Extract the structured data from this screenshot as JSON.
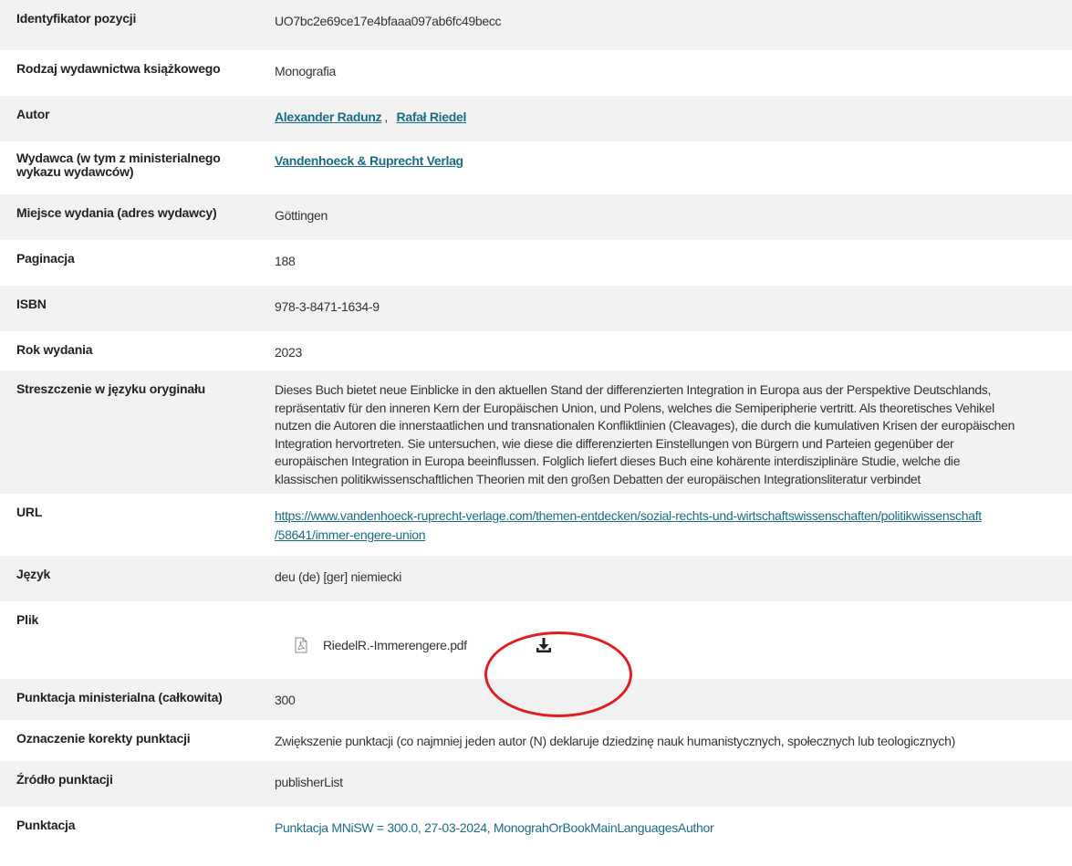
{
  "rows": [
    {
      "label": "Identyfikator pozycji",
      "value": "UO7bc2e69ce17e4bfaaa097ab6fc49becc"
    },
    {
      "label": "Rodzaj wydawnictwa książkowego",
      "value": "Monografia"
    },
    {
      "label": "Autor",
      "authors": [
        "Alexander Radunz",
        "Rafał Riedel"
      ],
      "separator": ","
    },
    {
      "label": "Wydawca (w tym z ministerialnego wykazu wydawców)",
      "publisher": "Vandenhoeck & Ruprecht Verlag"
    },
    {
      "label": "Miejsce wydania (adres wydawcy)",
      "value": "Göttingen"
    },
    {
      "label": "Paginacja",
      "value": "188"
    },
    {
      "label": "ISBN",
      "value": "978-3-8471-1634-9"
    },
    {
      "label": "Rok wydania",
      "value": "2023"
    },
    {
      "label": "Streszczenie w języku oryginału",
      "lines": [
        "Dieses Buch bietet neue Einblicke in den aktuellen Stand der differenzierten Integration in Europa aus der Perspektive Deutschlands,",
        "repräsentativ für den inneren Kern der Europäischen Union, und Polens, welches die Semiperipherie vertritt. Als theoretisches Vehikel",
        "nutzen die Autoren die innerstaatlichen und transnationalen Konfliktlinien (Cleavages), die durch die kumulativen Krisen der europäischen",
        "Integration hervortreten. Sie untersuchen, wie diese die differenzierten Einstellungen von Bürgern und Parteien gegenüber der",
        "europäischen Integration in Europa beeinflussen. Folglich liefert dieses Buch eine kohärente interdisziplinäre Studie, welche die",
        "klassischen politikwissenschaftlichen Theorien mit den großen Debatten der europäischen Integrationsliteratur verbindet"
      ]
    },
    {
      "label": "URL",
      "url_lines": [
        "https://www.vandenhoeck-ruprecht-verlage.com/themen-entdecken/sozial-rechts-und-wirtschaftswissenschaften/politikwissenschaft",
        "/58641/immer-engere-union"
      ]
    },
    {
      "label": "Język",
      "value": "deu (de) [ger] niemiecki"
    },
    {
      "label": "Plik",
      "file_name": "RiedelR.-Immerengere.pdf",
      "file_icon": "pdf-icon",
      "download_icon": "download-icon"
    },
    {
      "label": "Punktacja ministerialna (całkowita)",
      "value": "300"
    },
    {
      "label": "Oznaczenie korekty punktacji",
      "value": "Zwiększenie punktacji (co najmniej jeden autor (N) deklaruje dziedzinę nauk humanistycznych, społecznych lub teologicznych)"
    },
    {
      "label": "Źródło punktacji",
      "value": "publisherList"
    },
    {
      "label": "Punktacja",
      "score_link": "Punktacja MNiSW = 300.0, 27-03-2024, MonograhOrBookMainLanguagesAuthor"
    }
  ],
  "colors": {
    "link": "#1a6d87",
    "row_alt": "#f2f2f2",
    "highlight_circle": "#e02020"
  }
}
